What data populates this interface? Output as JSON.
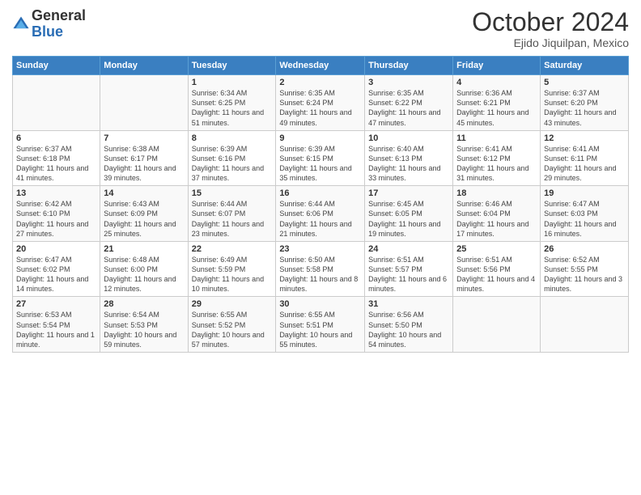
{
  "header": {
    "logo": {
      "general": "General",
      "blue": "Blue"
    },
    "title": "October 2024",
    "location": "Ejido Jiquilpan, Mexico"
  },
  "days_of_week": [
    "Sunday",
    "Monday",
    "Tuesday",
    "Wednesday",
    "Thursday",
    "Friday",
    "Saturday"
  ],
  "weeks": [
    [
      {
        "day": "",
        "info": ""
      },
      {
        "day": "",
        "info": ""
      },
      {
        "day": "1",
        "info": "Sunrise: 6:34 AM\nSunset: 6:25 PM\nDaylight: 11 hours and 51 minutes."
      },
      {
        "day": "2",
        "info": "Sunrise: 6:35 AM\nSunset: 6:24 PM\nDaylight: 11 hours and 49 minutes."
      },
      {
        "day": "3",
        "info": "Sunrise: 6:35 AM\nSunset: 6:22 PM\nDaylight: 11 hours and 47 minutes."
      },
      {
        "day": "4",
        "info": "Sunrise: 6:36 AM\nSunset: 6:21 PM\nDaylight: 11 hours and 45 minutes."
      },
      {
        "day": "5",
        "info": "Sunrise: 6:37 AM\nSunset: 6:20 PM\nDaylight: 11 hours and 43 minutes."
      }
    ],
    [
      {
        "day": "6",
        "info": "Sunrise: 6:37 AM\nSunset: 6:18 PM\nDaylight: 11 hours and 41 minutes."
      },
      {
        "day": "7",
        "info": "Sunrise: 6:38 AM\nSunset: 6:17 PM\nDaylight: 11 hours and 39 minutes."
      },
      {
        "day": "8",
        "info": "Sunrise: 6:39 AM\nSunset: 6:16 PM\nDaylight: 11 hours and 37 minutes."
      },
      {
        "day": "9",
        "info": "Sunrise: 6:39 AM\nSunset: 6:15 PM\nDaylight: 11 hours and 35 minutes."
      },
      {
        "day": "10",
        "info": "Sunrise: 6:40 AM\nSunset: 6:13 PM\nDaylight: 11 hours and 33 minutes."
      },
      {
        "day": "11",
        "info": "Sunrise: 6:41 AM\nSunset: 6:12 PM\nDaylight: 11 hours and 31 minutes."
      },
      {
        "day": "12",
        "info": "Sunrise: 6:41 AM\nSunset: 6:11 PM\nDaylight: 11 hours and 29 minutes."
      }
    ],
    [
      {
        "day": "13",
        "info": "Sunrise: 6:42 AM\nSunset: 6:10 PM\nDaylight: 11 hours and 27 minutes."
      },
      {
        "day": "14",
        "info": "Sunrise: 6:43 AM\nSunset: 6:09 PM\nDaylight: 11 hours and 25 minutes."
      },
      {
        "day": "15",
        "info": "Sunrise: 6:44 AM\nSunset: 6:07 PM\nDaylight: 11 hours and 23 minutes."
      },
      {
        "day": "16",
        "info": "Sunrise: 6:44 AM\nSunset: 6:06 PM\nDaylight: 11 hours and 21 minutes."
      },
      {
        "day": "17",
        "info": "Sunrise: 6:45 AM\nSunset: 6:05 PM\nDaylight: 11 hours and 19 minutes."
      },
      {
        "day": "18",
        "info": "Sunrise: 6:46 AM\nSunset: 6:04 PM\nDaylight: 11 hours and 17 minutes."
      },
      {
        "day": "19",
        "info": "Sunrise: 6:47 AM\nSunset: 6:03 PM\nDaylight: 11 hours and 16 minutes."
      }
    ],
    [
      {
        "day": "20",
        "info": "Sunrise: 6:47 AM\nSunset: 6:02 PM\nDaylight: 11 hours and 14 minutes."
      },
      {
        "day": "21",
        "info": "Sunrise: 6:48 AM\nSunset: 6:00 PM\nDaylight: 11 hours and 12 minutes."
      },
      {
        "day": "22",
        "info": "Sunrise: 6:49 AM\nSunset: 5:59 PM\nDaylight: 11 hours and 10 minutes."
      },
      {
        "day": "23",
        "info": "Sunrise: 6:50 AM\nSunset: 5:58 PM\nDaylight: 11 hours and 8 minutes."
      },
      {
        "day": "24",
        "info": "Sunrise: 6:51 AM\nSunset: 5:57 PM\nDaylight: 11 hours and 6 minutes."
      },
      {
        "day": "25",
        "info": "Sunrise: 6:51 AM\nSunset: 5:56 PM\nDaylight: 11 hours and 4 minutes."
      },
      {
        "day": "26",
        "info": "Sunrise: 6:52 AM\nSunset: 5:55 PM\nDaylight: 11 hours and 3 minutes."
      }
    ],
    [
      {
        "day": "27",
        "info": "Sunrise: 6:53 AM\nSunset: 5:54 PM\nDaylight: 11 hours and 1 minute."
      },
      {
        "day": "28",
        "info": "Sunrise: 6:54 AM\nSunset: 5:53 PM\nDaylight: 10 hours and 59 minutes."
      },
      {
        "day": "29",
        "info": "Sunrise: 6:55 AM\nSunset: 5:52 PM\nDaylight: 10 hours and 57 minutes."
      },
      {
        "day": "30",
        "info": "Sunrise: 6:55 AM\nSunset: 5:51 PM\nDaylight: 10 hours and 55 minutes."
      },
      {
        "day": "31",
        "info": "Sunrise: 6:56 AM\nSunset: 5:50 PM\nDaylight: 10 hours and 54 minutes."
      },
      {
        "day": "",
        "info": ""
      },
      {
        "day": "",
        "info": ""
      }
    ]
  ]
}
